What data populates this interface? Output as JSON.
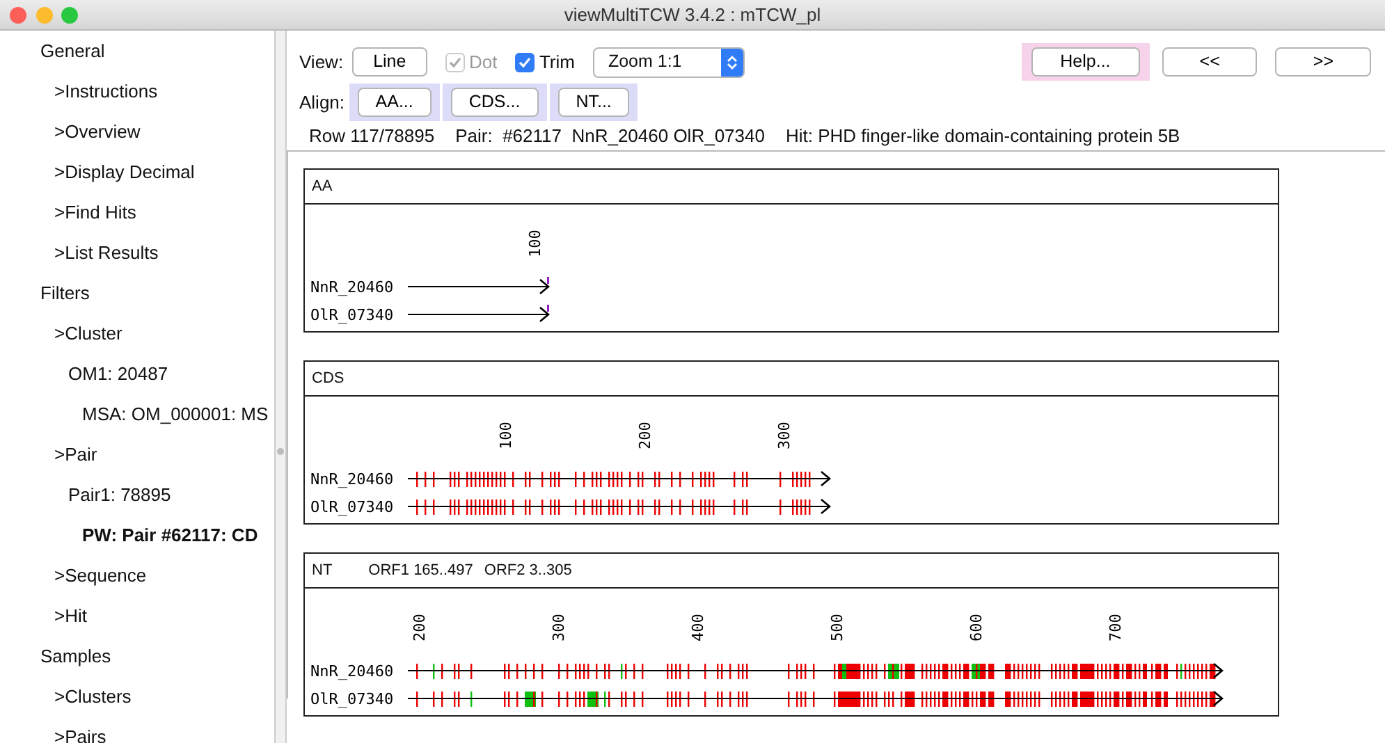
{
  "window": {
    "title": "viewMultiTCW 3.4.2 : mTCW_pl"
  },
  "sidebar": {
    "items": [
      {
        "label": "General",
        "selected": false,
        "children": [
          {
            "label": ">Instructions",
            "selected": false
          },
          {
            "label": ">Overview",
            "selected": false
          },
          {
            "label": ">Display Decimal",
            "selected": false
          },
          {
            "label": ">Find Hits",
            "selected": false
          },
          {
            "label": ">List Results",
            "selected": false
          }
        ]
      },
      {
        "label": "Filters",
        "selected": false,
        "children": [
          {
            "label": ">Cluster",
            "selected": false,
            "children": [
              {
                "label": "OM1: 20487",
                "selected": false,
                "children": [
                  {
                    "label": "MSA: OM_000001: MS",
                    "selected": false
                  }
                ]
              }
            ]
          },
          {
            "label": ">Pair",
            "selected": false,
            "children": [
              {
                "label": "Pair1: 78895",
                "selected": false,
                "children": [
                  {
                    "label": "PW: Pair #62117: CD",
                    "selected": true
                  }
                ]
              }
            ]
          },
          {
            "label": ">Sequence",
            "selected": false
          },
          {
            "label": ">Hit",
            "selected": false
          }
        ]
      },
      {
        "label": "Samples",
        "selected": false,
        "children": [
          {
            "label": ">Clusters",
            "selected": false
          },
          {
            "label": ">Pairs",
            "selected": false
          }
        ]
      }
    ]
  },
  "toolbar": {
    "view_label": "View:",
    "line_button": "Line",
    "checkboxes": [
      {
        "label": "Dot",
        "checked": true,
        "disabled": true
      },
      {
        "label": "Trim",
        "checked": true,
        "disabled": false
      }
    ],
    "zoom": "Zoom 1:1",
    "help_button": "Help...",
    "prev_button": "<<",
    "next_button": ">>"
  },
  "align": {
    "label": "Align:",
    "buttons": [
      "AA...",
      "CDS...",
      "NT..."
    ]
  },
  "info": [
    "Row 117/78895",
    "Pair:  #62117  NnR_20460 OlR_07340",
    "Hit: PHD finger-like domain-containing protein 5B"
  ],
  "panels": [
    {
      "title": "AA",
      "ticks": [
        "100"
      ],
      "sequences": [
        "NnR_20460",
        "OlR_07340"
      ]
    },
    {
      "title": "CDS",
      "ticks": [
        "100",
        "200",
        "300"
      ],
      "sequences": [
        "NnR_20460",
        "OlR_07340"
      ]
    },
    {
      "title": "NT",
      "orfs": [
        "ORF1 165..497",
        "ORF2 3..305"
      ],
      "ticks": [
        "200",
        "300",
        "400",
        "500",
        "600",
        "700"
      ],
      "sequences": [
        "NnR_20460",
        "OlR_07340"
      ]
    }
  ]
}
